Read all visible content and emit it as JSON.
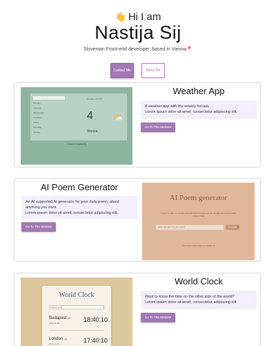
{
  "hero": {
    "greeting": "Hi I am",
    "wave_icon": "waving-hand-icon",
    "name": "Nastija Sij",
    "tagline": "Slovenian Front-end developer, based in Vienna",
    "location_icon": "map-pin-icon"
  },
  "nav": {
    "contact_label": "Contact Me",
    "about_label": "About Me"
  },
  "colors": {
    "accent": "#a478b3",
    "desc_bg": "#f3eefb",
    "weather_bg": "#8db5a2",
    "poem_bg": "#dfb79b",
    "clock_bg": "#dbc79b"
  },
  "projects": [
    {
      "title": "Weather App",
      "description_line1": "A weather app with the weekly forcast.",
      "description_line2": "Lorem ipsum dolor sit amet, consectetur adipiscing elit.",
      "button_label": "Go To The Website",
      "preview": {
        "days": [
          "Monday",
          "Tuesday",
          "Wednesday",
          "Thursday",
          "Friday",
          "Saturday",
          "Sunday"
        ],
        "temperature": "4",
        "city": "Vienna",
        "top_text": "Sunday 4:32 PM",
        "footer": "Coded by Nastija Sij"
      }
    },
    {
      "title": "AI Poem Generator",
      "description_line1": "An AI supported AI generator for your daily poem, about anything you want.",
      "description_line2": "Lorem ipsum dolor sit amet, consectetur adipiscing elit.",
      "button_label": "Go To The Website",
      "preview": {
        "title": "AI Poem generator",
        "subtitle": "Poetry is when an emotion has found its thought and the thought has found words",
        "subtitle_author": "Robert Frost",
        "input_placeholder": "Enter the topic for your poem",
        "generate_label": "Generate",
        "footer": "This project was coded by Nastija Sij"
      }
    },
    {
      "title": "World Clock",
      "description_line1": "Want to know the time on the other side of the world?",
      "description_line2": "Lorem ipsum dolor sit amet, consectetur adipiscing elit.",
      "button_label": "Go To The Website",
      "preview": {
        "title": "World Clock",
        "select_value": "Select a city",
        "cities": [
          {
            "name": "Budapest",
            "zone": "AM",
            "date": "2023-11-08",
            "time": "18:40:10"
          },
          {
            "name": "London",
            "zone": "AM",
            "date": "2023-11-08",
            "time": "17:40:10"
          }
        ]
      }
    }
  ]
}
